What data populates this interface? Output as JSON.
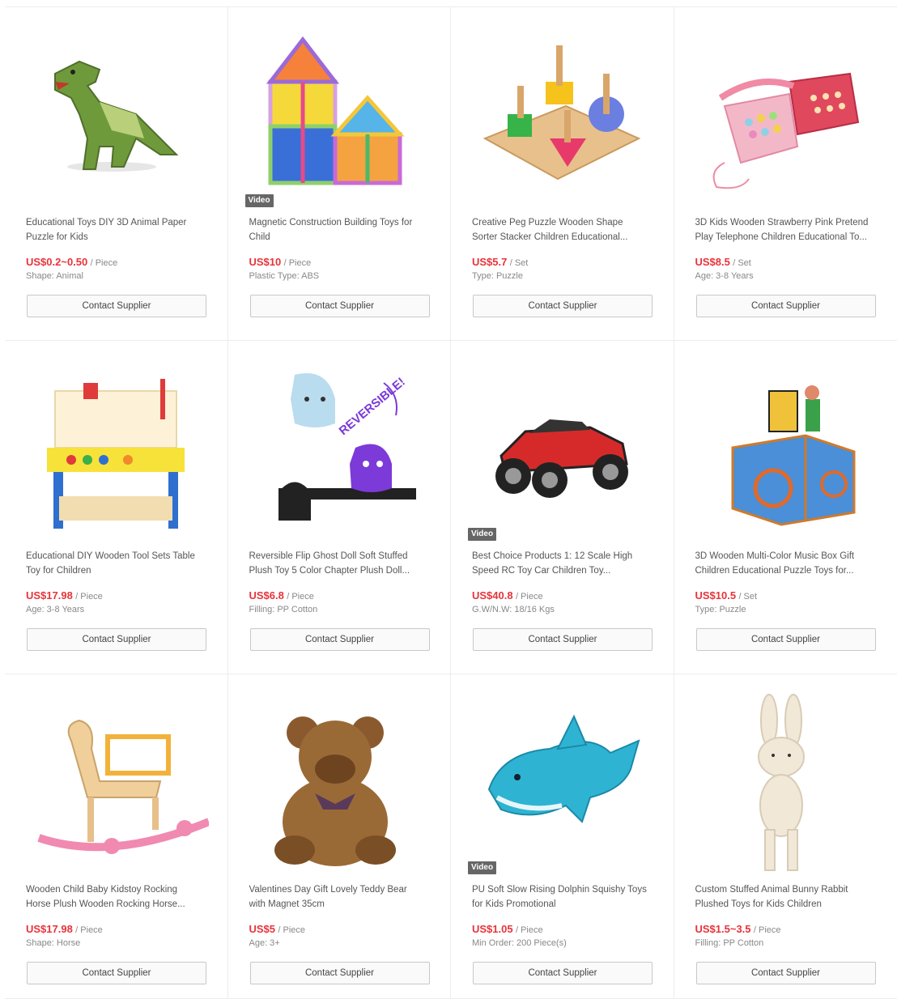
{
  "video_label": "Video",
  "contact_label": "Contact Supplier",
  "colors": {
    "price": "#e8333a",
    "border": "#ececec"
  },
  "products": [
    {
      "icon": "dinosaur-puzzle-icon",
      "title": "Educational Toys DIY 3D Animal Paper Puzzle for Kids",
      "price": "US$0.2~0.50",
      "unit": "/ Piece",
      "attr": "Shape: Animal",
      "video": false
    },
    {
      "icon": "magnetic-tiles-icon",
      "title": "Magnetic Construction Building Toys for Child",
      "price": "US$10",
      "unit": "/ Piece",
      "attr": "Plastic Type: ABS",
      "video": true
    },
    {
      "icon": "peg-puzzle-icon",
      "title": "Creative Peg Puzzle Wooden Shape Sorter Stacker Children Educational...",
      "price": "US$5.7",
      "unit": "/ Set",
      "attr": "Type: Puzzle",
      "video": false
    },
    {
      "icon": "pink-telephone-icon",
      "title": "3D Kids Wooden Strawberry Pink Pretend Play Telephone Children Educational To...",
      "price": "US$8.5",
      "unit": "/ Set",
      "attr": "Age: 3-8 Years",
      "video": false
    },
    {
      "icon": "tool-bench-icon",
      "title": "Educational DIY Wooden Tool Sets Table Toy for Children",
      "price": "US$17.98",
      "unit": "/ Piece",
      "attr": "Age: 3-8 Years",
      "video": false
    },
    {
      "icon": "ghost-plush-icon",
      "title": "Reversible Flip Ghost Doll Soft Stuffed Plush Toy 5 Color Chapter Plush Doll...",
      "price": "US$6.8",
      "unit": "/ Piece",
      "attr": "Filling: PP Cotton",
      "video": false,
      "image_text": "REVERSIBLE!"
    },
    {
      "icon": "rc-car-icon",
      "title": "Best Choice Products 1: 12 Scale High Speed RC Toy Car Children Toy...",
      "price": "US$40.8",
      "unit": "/ Piece",
      "attr": "G.W/N.W: 18/16 Kgs",
      "video": true
    },
    {
      "icon": "music-box-icon",
      "title": "3D Wooden Multi-Color Music Box Gift Children Educational Puzzle Toys for...",
      "price": "US$10.5",
      "unit": "/ Set",
      "attr": "Type: Puzzle",
      "video": false
    },
    {
      "icon": "rocking-horse-icon",
      "title": "Wooden Child Baby Kidstoy Rocking Horse Plush Wooden Rocking Horse...",
      "price": "US$17.98",
      "unit": "/ Piece",
      "attr": "Shape: Horse",
      "video": false
    },
    {
      "icon": "teddy-bear-icon",
      "title": "Valentines Day Gift Lovely Teddy Bear with Magnet 35cm",
      "price": "US$5",
      "unit": "/ Piece",
      "attr": "Age: 3+",
      "video": false
    },
    {
      "icon": "dolphin-squishy-icon",
      "title": "PU Soft Slow Rising Dolphin Squishy Toys for Kids Promotional",
      "price": "US$1.05",
      "unit": "/ Piece",
      "attr": "Min Order: 200 Piece(s)",
      "video": true
    },
    {
      "icon": "bunny-plush-icon",
      "title": "Custom Stuffed Animal Bunny Rabbit Plushed Toys for Kids Children",
      "price": "US$1.5~3.5",
      "unit": "/ Piece",
      "attr": "Filling: PP Cotton",
      "video": false
    }
  ]
}
